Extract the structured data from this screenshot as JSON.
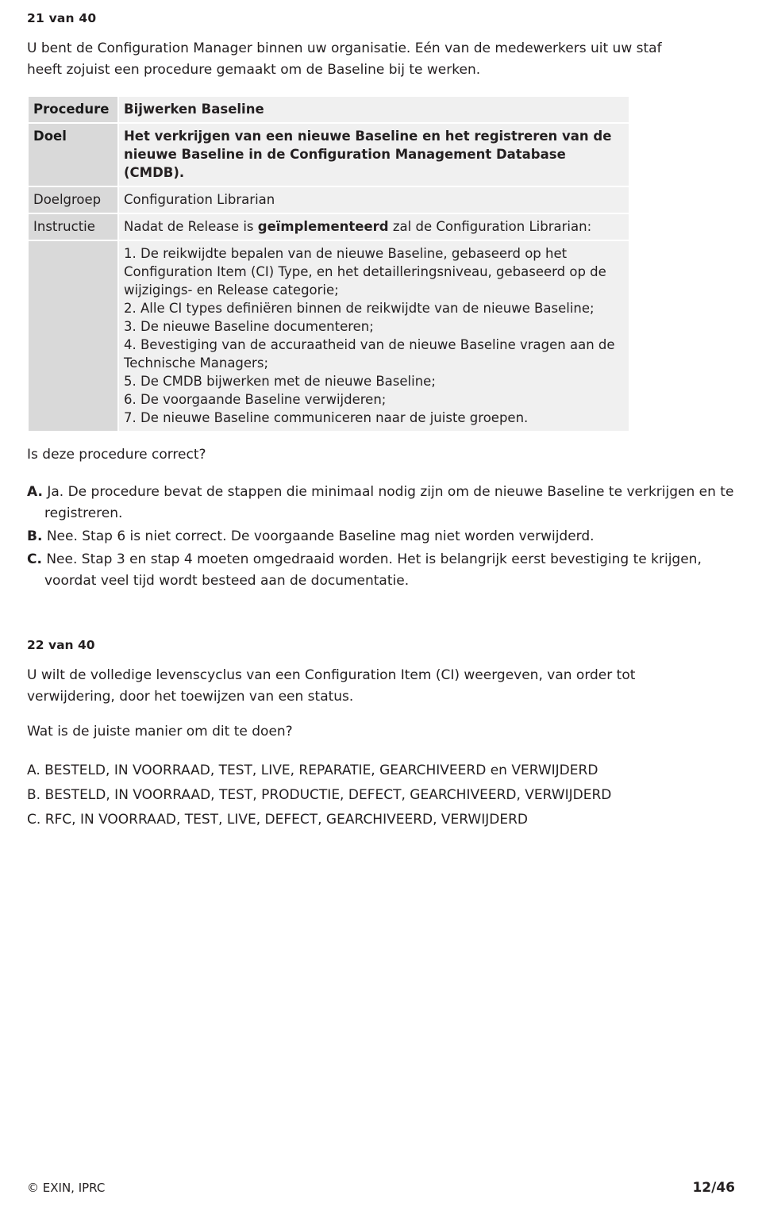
{
  "question21": {
    "number": "21 van 40",
    "intro_line1": "U bent de Configuration Manager binnen uw organisatie. Eén van de medewerkers uit uw staf",
    "intro_line2": "heeft zojuist een procedure gemaakt om de Baseline bij te werken.",
    "table": {
      "row_procedure_label": "Procedure",
      "row_procedure_value": "Bijwerken Baseline",
      "row_doel_label": "Doel",
      "row_doel_value": "Het verkrijgen van een nieuwe Baseline en het registreren van de nieuwe Baseline in de Configuration Management Database (CMDB).",
      "row_doelgroep_label": "Doelgroep",
      "row_doelgroep_value": "Configuration Librarian",
      "row_instructie_label": "Instructie",
      "row_instructie_value_pre": "Nadat de Release is ",
      "row_instructie_value_bold": "geïmplementeerd",
      "row_instructie_value_post": " zal de Configuration Librarian:",
      "steps": [
        "1. De reikwijdte bepalen van de nieuwe Baseline, gebaseerd op het Configuration Item (CI) Type, en het detailleringsniveau, gebaseerd op de wijzigings- en Release categorie;",
        "2. Alle CI types definiëren binnen de reikwijdte van de nieuwe Baseline;",
        "3. De nieuwe Baseline documenteren;",
        "4. Bevestiging van de accuraatheid van de nieuwe Baseline vragen aan de Technische Managers;",
        "5. De CMDB bijwerken met de nieuwe Baseline;",
        "6. De voorgaande Baseline verwijderen;",
        "7. De nieuwe Baseline communiceren naar de juiste groepen."
      ]
    },
    "question_line": "Is deze procedure correct?",
    "answers": [
      {
        "letter": "A.",
        "text": "Ja. De procedure bevat de stappen die minimaal nodig zijn om de nieuwe Baseline te verkrijgen en te registreren."
      },
      {
        "letter": "B.",
        "text": "Nee. Stap 6 is niet correct. De voorgaande Baseline mag niet worden verwijderd."
      },
      {
        "letter": "C.",
        "text": "Nee. Stap 3 en stap 4 moeten omgedraaid worden. Het is belangrijk eerst bevestiging te krijgen, voordat veel tijd wordt besteed aan de documentatie."
      }
    ]
  },
  "question22": {
    "number": "22 van 40",
    "body_line1": "U wilt de volledige levenscyclus van een Configuration Item (CI) weergeven, van order tot",
    "body_line2": "verwijdering, door het toewijzen van een status.",
    "ask": "Wat is de juiste manier om dit te doen?",
    "answers": [
      {
        "letter": "A.",
        "text": "BESTELD, IN VOORRAAD, TEST, LIVE, REPARATIE, GEARCHIVEERD en VERWIJDERD"
      },
      {
        "letter": "B.",
        "text": "BESTELD, IN VOORRAAD, TEST, PRODUCTIE, DEFECT, GEARCHIVEERD, VERWIJDERD"
      },
      {
        "letter": "C.",
        "text": "RFC, IN VOORRAAD, TEST, LIVE, DEFECT, GEARCHIVEERD, VERWIJDERD"
      }
    ]
  },
  "footer": {
    "copyright": "© EXIN, IPRC",
    "page": "12/46"
  }
}
